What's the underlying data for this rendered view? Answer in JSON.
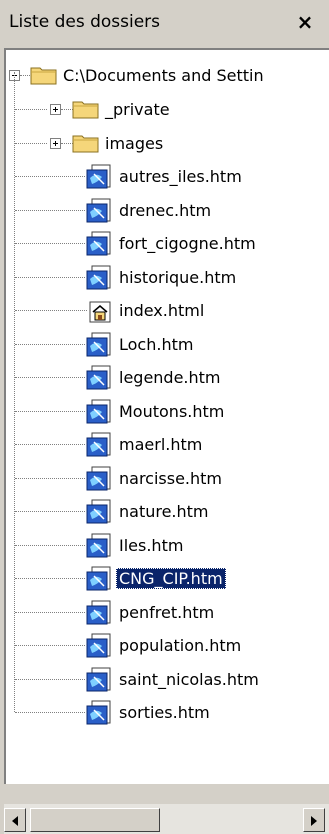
{
  "panel": {
    "title": "Liste des dossiers",
    "close_label": "×"
  },
  "tree": {
    "root": {
      "label": "C:\\Documents and Settin",
      "expanded": true
    },
    "folders": [
      {
        "label": "_private",
        "expanded": false
      },
      {
        "label": "images",
        "expanded": false
      }
    ],
    "files": [
      {
        "label": "autres_iles.htm",
        "icon": "htm-file-icon"
      },
      {
        "label": "drenec.htm",
        "icon": "htm-file-icon"
      },
      {
        "label": "fort_cigogne.htm",
        "icon": "htm-file-icon"
      },
      {
        "label": "historique.htm",
        "icon": "htm-file-icon"
      },
      {
        "label": "index.html",
        "icon": "home-page-icon"
      },
      {
        "label": "Loch.htm",
        "icon": "htm-file-icon"
      },
      {
        "label": "legende.htm",
        "icon": "htm-file-icon"
      },
      {
        "label": "Moutons.htm",
        "icon": "htm-file-icon"
      },
      {
        "label": "maerl.htm",
        "icon": "htm-file-icon"
      },
      {
        "label": "narcisse.htm",
        "icon": "htm-file-icon"
      },
      {
        "label": "nature.htm",
        "icon": "htm-file-icon"
      },
      {
        "label": "Iles.htm",
        "icon": "htm-file-icon"
      },
      {
        "label": "CNG_CIP.htm",
        "icon": "htm-file-icon",
        "selected": true
      },
      {
        "label": "penfret.htm",
        "icon": "htm-file-icon"
      },
      {
        "label": "population.htm",
        "icon": "htm-file-icon"
      },
      {
        "label": "saint_nicolas.htm",
        "icon": "htm-file-icon"
      },
      {
        "label": "sorties.htm",
        "icon": "htm-file-icon"
      }
    ]
  },
  "colors": {
    "selection": "#0a246a",
    "chrome": "#d4d0c8",
    "folder": "#f5d67a"
  }
}
